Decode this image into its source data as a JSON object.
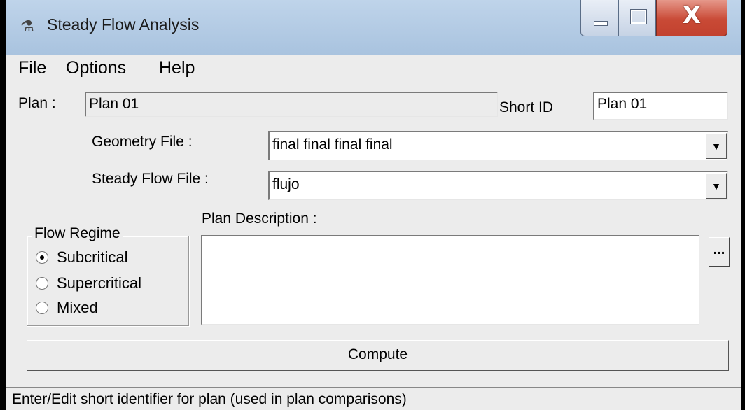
{
  "window": {
    "title": "Steady Flow Analysis",
    "icon": "app-figure-icon",
    "controls": {
      "minimize": "minimize-icon",
      "maximize": "maximize-icon",
      "close": "X"
    }
  },
  "menu": {
    "items": [
      "File",
      "Options",
      "Help"
    ]
  },
  "form": {
    "plan_label": "Plan :",
    "plan_value": "Plan 01",
    "short_id_label": "Short ID",
    "short_id_value": "Plan 01",
    "geometry_label": "Geometry File :",
    "geometry_value": "final final final final",
    "steady_flow_label": "Steady Flow File :",
    "steady_flow_value": "flujo",
    "flow_regime": {
      "legend": "Flow Regime",
      "options": [
        "Subcritical",
        "Supercritical",
        "Mixed"
      ],
      "selected": "Subcritical"
    },
    "description_label": "Plan Description :",
    "description_value": "",
    "ellipsis_label": "...",
    "compute_label": "Compute"
  },
  "status": {
    "text": "Enter/Edit short identifier for plan (used in plan comparisons)"
  }
}
